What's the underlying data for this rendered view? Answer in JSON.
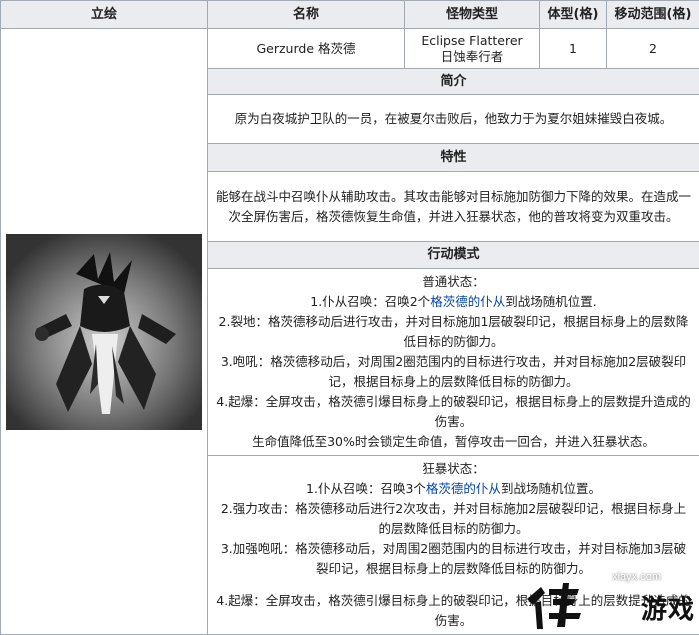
{
  "headers": {
    "portrait": "立绘",
    "name": "名称",
    "monster_type": "怪物类型",
    "body_size": "体型(格)",
    "move_range": "移动范围(格)"
  },
  "monster": {
    "name": "Gerzurde 格茨德",
    "type_en": "Eclipse Flatterer",
    "type_cn": "日蚀奉行者",
    "body_size": "1",
    "move_range": "2"
  },
  "sections": {
    "intro_title": "简介",
    "intro_text": "原为白夜城护卫队的一员，在被夏尔击败后，他致力于为夏尔姐妹摧毁白夜城。",
    "traits_title": "特性",
    "traits_text": "能够在战斗中召唤仆从辅助攻击。其攻击能够对目标施加防御力下降的效果。在造成一次全屏伤害后，格茨德恢复生命值，并进入狂暴状态，他的普攻将变为双重攻击。",
    "action_title": "行动模式"
  },
  "normal_state": {
    "title": "普通状态：",
    "skill1_prefix": "1.仆从召唤：召唤2个",
    "skill1_link": "格茨德的仆从",
    "skill1_suffix": "到战场随机位置.",
    "skill2": "2.裂地：格茨德移动后进行攻击，并对目标施加1层破裂印记，根据目标身上的层数降低目标的防御力。",
    "skill3": "3.咆吼：格茨德移动后，对周围2圈范围内的目标进行攻击，并对目标施加2层破裂印记，根据目标身上的层数降低目标的防御力。",
    "skill4": "4.起爆：全屏攻击，格茨德引爆目标身上的破裂印记，根据目标身上的层数提升造成的伤害。",
    "note": "生命值降低至30%时会锁定生命值，暂停攻击一回合，并进入狂暴状态。"
  },
  "berserk_state": {
    "title": "狂暴状态：",
    "skill1_prefix": "1.仆从召唤：召唤3个",
    "skill1_link": "格茨德的仆从",
    "skill1_suffix": "到战场随机位置。",
    "skill2": "2.强力攻击：格茨德移动后进行2次攻击，并对目标施加2层破裂印记，根据目标身上的层数降低目标的防御力。",
    "skill3": "3.加强咆吼：格茨德移动后，对周围2圈范围内的目标进行攻击，并对目标施加3层破裂印记，根据目标身上的层数降低目标的防御力。",
    "skill4": "4.起爆：全屏攻击，格茨德引爆目标身上的破裂印记，根据目标身上的层数提升造成的伤害。"
  },
  "watermark": {
    "url": "xiayx.com",
    "name": "游戏"
  },
  "colors": {
    "header_bg": "#eaecf0",
    "border": "#a2a9b1",
    "link": "#0645ad"
  }
}
